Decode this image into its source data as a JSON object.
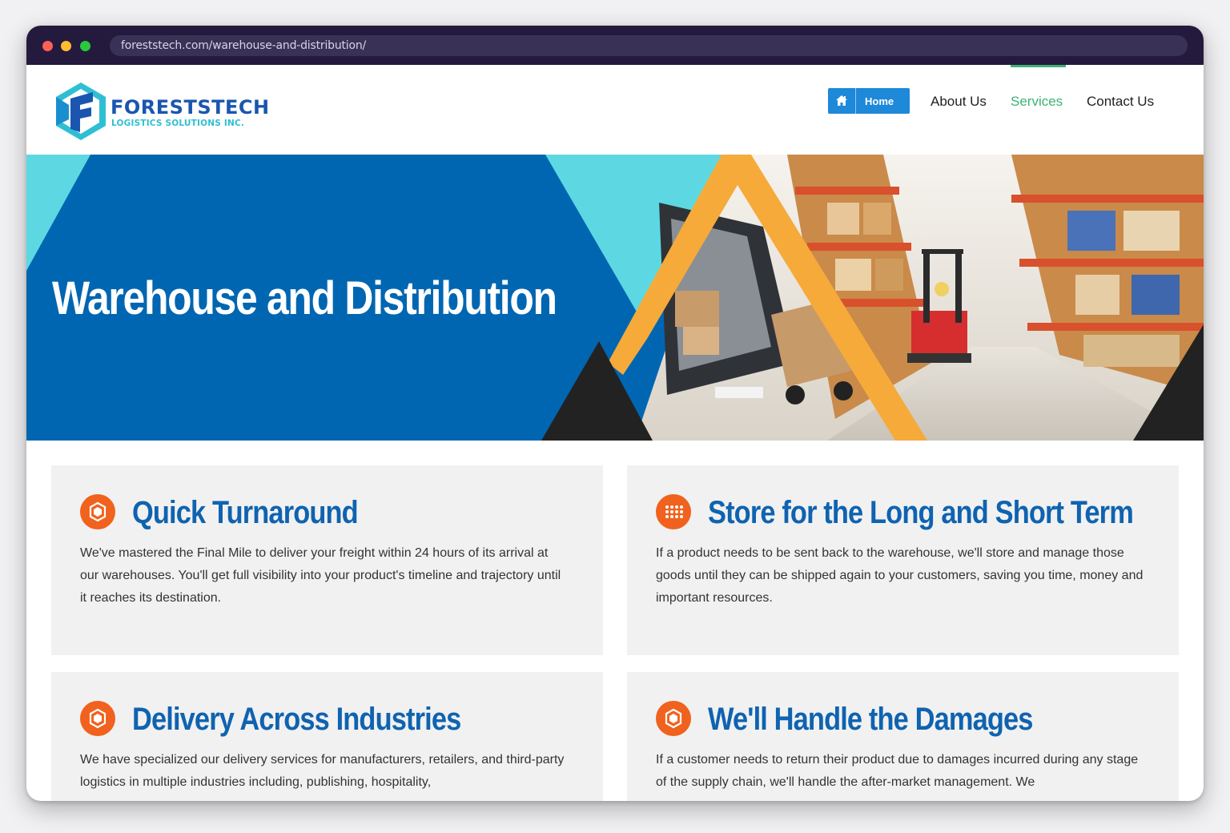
{
  "browser": {
    "url": "foreststech.com/warehouse-and-distribution/"
  },
  "logo": {
    "title": "FORESTSTECH",
    "subtitle": "LOGISTICS SOLUTIONS INC."
  },
  "nav": {
    "home": "Home",
    "about": "About Us",
    "services": "Services",
    "contact": "Contact Us",
    "active": "Services",
    "active_color": "#3cb371",
    "home_button_color": "#1e88d9"
  },
  "hero": {
    "title": "Warehouse and Distribution",
    "background_color": "#0066b2"
  },
  "cards": [
    {
      "icon": "gear-polygon-icon",
      "title": "Quick Turnaround",
      "text": "We've mastered the Final Mile to deliver your freight within 24 hours of its arrival at our warehouses. You'll get full visibility into your product's timeline and trajectory until it reaches its destination."
    },
    {
      "icon": "grid-dots-icon",
      "title": "Store for the Long and Short Term",
      "text": "If a product needs to be sent back to the warehouse, we'll store and manage those goods until they can be shipped again to your customers, saving you time, money and important resources."
    },
    {
      "icon": "gear-polygon-icon",
      "title": "Delivery Across Industries",
      "text": "We have specialized our delivery services for manufacturers, retailers, and third-party logistics in multiple industries including, publishing, hospitality,"
    },
    {
      "icon": "gear-polygon-icon",
      "title": "We'll Handle the Damages",
      "text": "If a customer needs to return their product due to damages incurred during any stage of the supply chain, we'll handle the after-market management. We"
    }
  ],
  "colors": {
    "accent_orange": "#f0621e",
    "heading_blue": "#0f63b0",
    "card_background": "#f1f1f1"
  }
}
